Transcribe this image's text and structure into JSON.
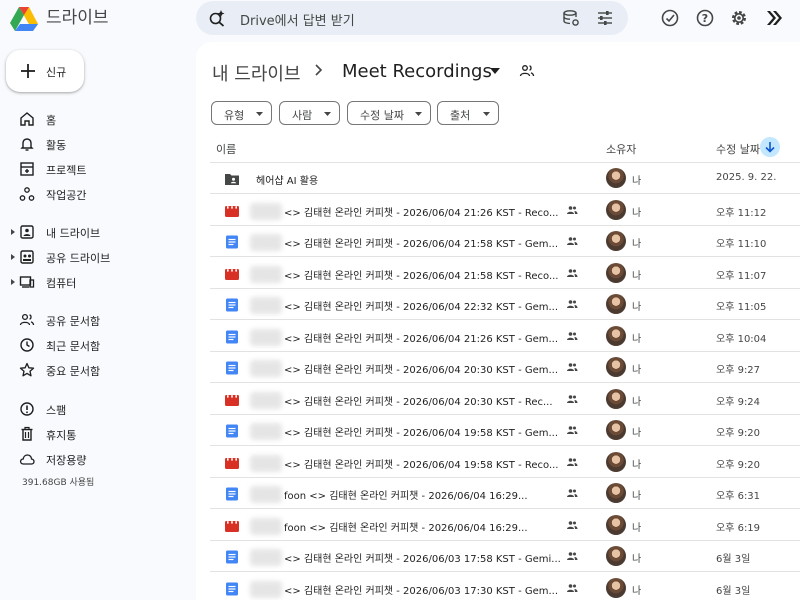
{
  "header": {
    "brand": "드라이브",
    "search_placeholder": "Drive에서 답변 받기"
  },
  "sidebar": {
    "new_label": "신규",
    "items": [
      {
        "label": "홈",
        "icon": "home-icon"
      },
      {
        "label": "활동",
        "icon": "bell-icon"
      },
      {
        "label": "프로젝트",
        "icon": "project-icon"
      },
      {
        "label": "작업공간",
        "icon": "workspace-icon"
      },
      {
        "label": "내 드라이브",
        "icon": "my-drive-icon"
      },
      {
        "label": "공유 드라이브",
        "icon": "shared-drive-icon"
      },
      {
        "label": "컴퓨터",
        "icon": "computer-icon"
      },
      {
        "label": "공유 문서함",
        "icon": "people-icon"
      },
      {
        "label": "최근 문서함",
        "icon": "clock-icon"
      },
      {
        "label": "중요 문서함",
        "icon": "star-icon"
      },
      {
        "label": "스팸",
        "icon": "spam-icon"
      },
      {
        "label": "휴지통",
        "icon": "trash-icon"
      },
      {
        "label": "저장용량",
        "icon": "cloud-icon"
      }
    ],
    "storage_used": "391.68GB 사용됨"
  },
  "breadcrumb": {
    "root": "내 드라이브",
    "current": "Meet Recordings"
  },
  "filters": [
    "유형",
    "사람",
    "수정 날짜",
    "출처"
  ],
  "table": {
    "columns": {
      "name": "이름",
      "owner": "소유자",
      "modified": "수정 날짜"
    },
    "rows": [
      {
        "type": "folder",
        "name": "헤어샵 AI 활용",
        "owner": "나",
        "date": "2025. 9. 22."
      },
      {
        "type": "video",
        "name": "<> 김태현 온라인 커피챗 - 2026/06/04 21:26 KST - Reco...",
        "owner": "나",
        "date": "오후 11:12"
      },
      {
        "type": "doc",
        "name": "<> 김태현 온라인 커피챗 - 2026/06/04 21:58 KST - Gem...",
        "owner": "나",
        "date": "오후 11:10"
      },
      {
        "type": "video",
        "name": "<> 김태현 온라인 커피챗 - 2026/06/04 21:58 KST - Reco...",
        "owner": "나",
        "date": "오후 11:07"
      },
      {
        "type": "doc",
        "name": "<> 김태현 온라인 커피챗 - 2026/06/04 22:32 KST - Gem...",
        "owner": "나",
        "date": "오후 11:05"
      },
      {
        "type": "doc",
        "name": "<> 김태현 온라인 커피챗 - 2026/06/04 21:26 KST - Gem...",
        "owner": "나",
        "date": "오후 10:04"
      },
      {
        "type": "doc",
        "name": "<> 김태현 온라인 커피챗 - 2026/06/04 20:30 KST - Gem...",
        "owner": "나",
        "date": "오후 9:27"
      },
      {
        "type": "video",
        "name": "<> 김태현 온라인 커피챗 - 2026/06/04 20:30 KST - Rec...",
        "owner": "나",
        "date": "오후 9:24"
      },
      {
        "type": "doc",
        "name": "<> 김태현 온라인 커피챗 - 2026/06/04 19:58 KST - Gem...",
        "owner": "나",
        "date": "오후 9:20"
      },
      {
        "type": "video",
        "name": "<> 김태현 온라인 커피챗 - 2026/06/04 19:58 KST - Reco...",
        "owner": "나",
        "date": "오후 9:20"
      },
      {
        "type": "doc",
        "name": "foon <> 김태현 온라인 커피챗 - 2026/06/04 16:29...",
        "owner": "나",
        "date": "오후 6:31"
      },
      {
        "type": "video",
        "name": "foon <> 김태현 온라인 커피챗 - 2026/06/04 16:29...",
        "owner": "나",
        "date": "오후 6:19"
      },
      {
        "type": "doc",
        "name": "<> 김태현 온라인 커피챗 - 2026/06/03 17:58 KST - Gemi...",
        "owner": "나",
        "date": "6월 3일"
      },
      {
        "type": "doc",
        "name": "<> 김태현 온라인 커피챗 - 2026/06/03 17:30 KST - Gem...",
        "owner": "나",
        "date": "6월 3일"
      }
    ]
  },
  "colors": {
    "accent": "#0b57d0",
    "sort_bg": "#c2e7ff",
    "video": "#d93025",
    "doc": "#4285f4"
  }
}
